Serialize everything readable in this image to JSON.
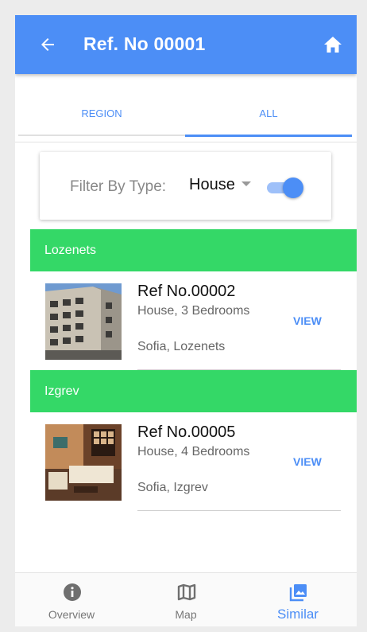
{
  "appbar": {
    "title": "Ref. No 00001"
  },
  "tabs": [
    {
      "label": "REGION"
    },
    {
      "label": "ALL"
    }
  ],
  "filter": {
    "label": "Filter By Type:",
    "selected": "House",
    "toggle_on": true
  },
  "groups": [
    {
      "name": "Lozenets",
      "items": [
        {
          "ref": "Ref No.00002",
          "desc": "House, 3 Bedrooms",
          "location": "Sofia, Lozenets",
          "action": "VIEW"
        }
      ]
    },
    {
      "name": "Izgrev",
      "items": [
        {
          "ref": "Ref No.00005",
          "desc": "House, 4 Bedrooms",
          "location": "Sofia, Izgrev",
          "action": "VIEW"
        }
      ]
    }
  ],
  "bottomnav": [
    {
      "label": "Overview",
      "icon": "info-icon"
    },
    {
      "label": "Map",
      "icon": "map-icon"
    },
    {
      "label": "Similar",
      "icon": "photo-library-icon",
      "active": true
    }
  ],
  "colors": {
    "primary": "#4c8ef6",
    "group_header": "#34d867",
    "background": "#ececec"
  }
}
